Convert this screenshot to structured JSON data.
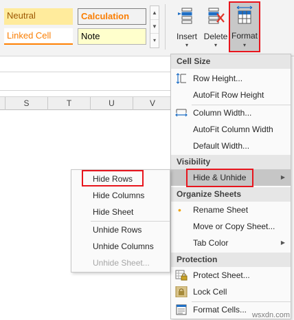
{
  "cell_styles": {
    "neutral": "Neutral",
    "calculation": "Calculation",
    "linked_cell": "Linked Cell",
    "note": "Note"
  },
  "cells_group": {
    "insert_label": "Insert",
    "delete_label": "Delete",
    "format_label": "Format"
  },
  "columns": [
    "S",
    "T",
    "U",
    "V"
  ],
  "format_menu": {
    "cell_size_header": "Cell Size",
    "row_height": "Row Height...",
    "autofit_row_height": "AutoFit Row Height",
    "column_width": "Column Width...",
    "autofit_column_width": "AutoFit Column Width",
    "default_width": "Default Width...",
    "visibility_header": "Visibility",
    "hide_unhide": "Hide & Unhide",
    "organize_header": "Organize Sheets",
    "rename_sheet": "Rename Sheet",
    "move_copy_sheet": "Move or Copy Sheet...",
    "tab_color": "Tab Color",
    "protection_header": "Protection",
    "protect_sheet": "Protect Sheet...",
    "lock_cell": "Lock Cell",
    "format_cells": "Format Cells..."
  },
  "hide_unhide_menu": {
    "hide_rows": "Hide Rows",
    "hide_columns": "Hide Columns",
    "hide_sheet": "Hide Sheet",
    "unhide_rows": "Unhide Rows",
    "unhide_columns": "Unhide Columns",
    "unhide_sheet": "Unhide Sheet..."
  },
  "watermark": "wsxdn.com",
  "colors": {
    "highlight_red": "#e8141c",
    "neutral_fill": "#ffeb9c",
    "calculation_text": "#fa7d00",
    "note_fill": "#ffffcc",
    "menu_header_fill": "#e6e6e6"
  }
}
